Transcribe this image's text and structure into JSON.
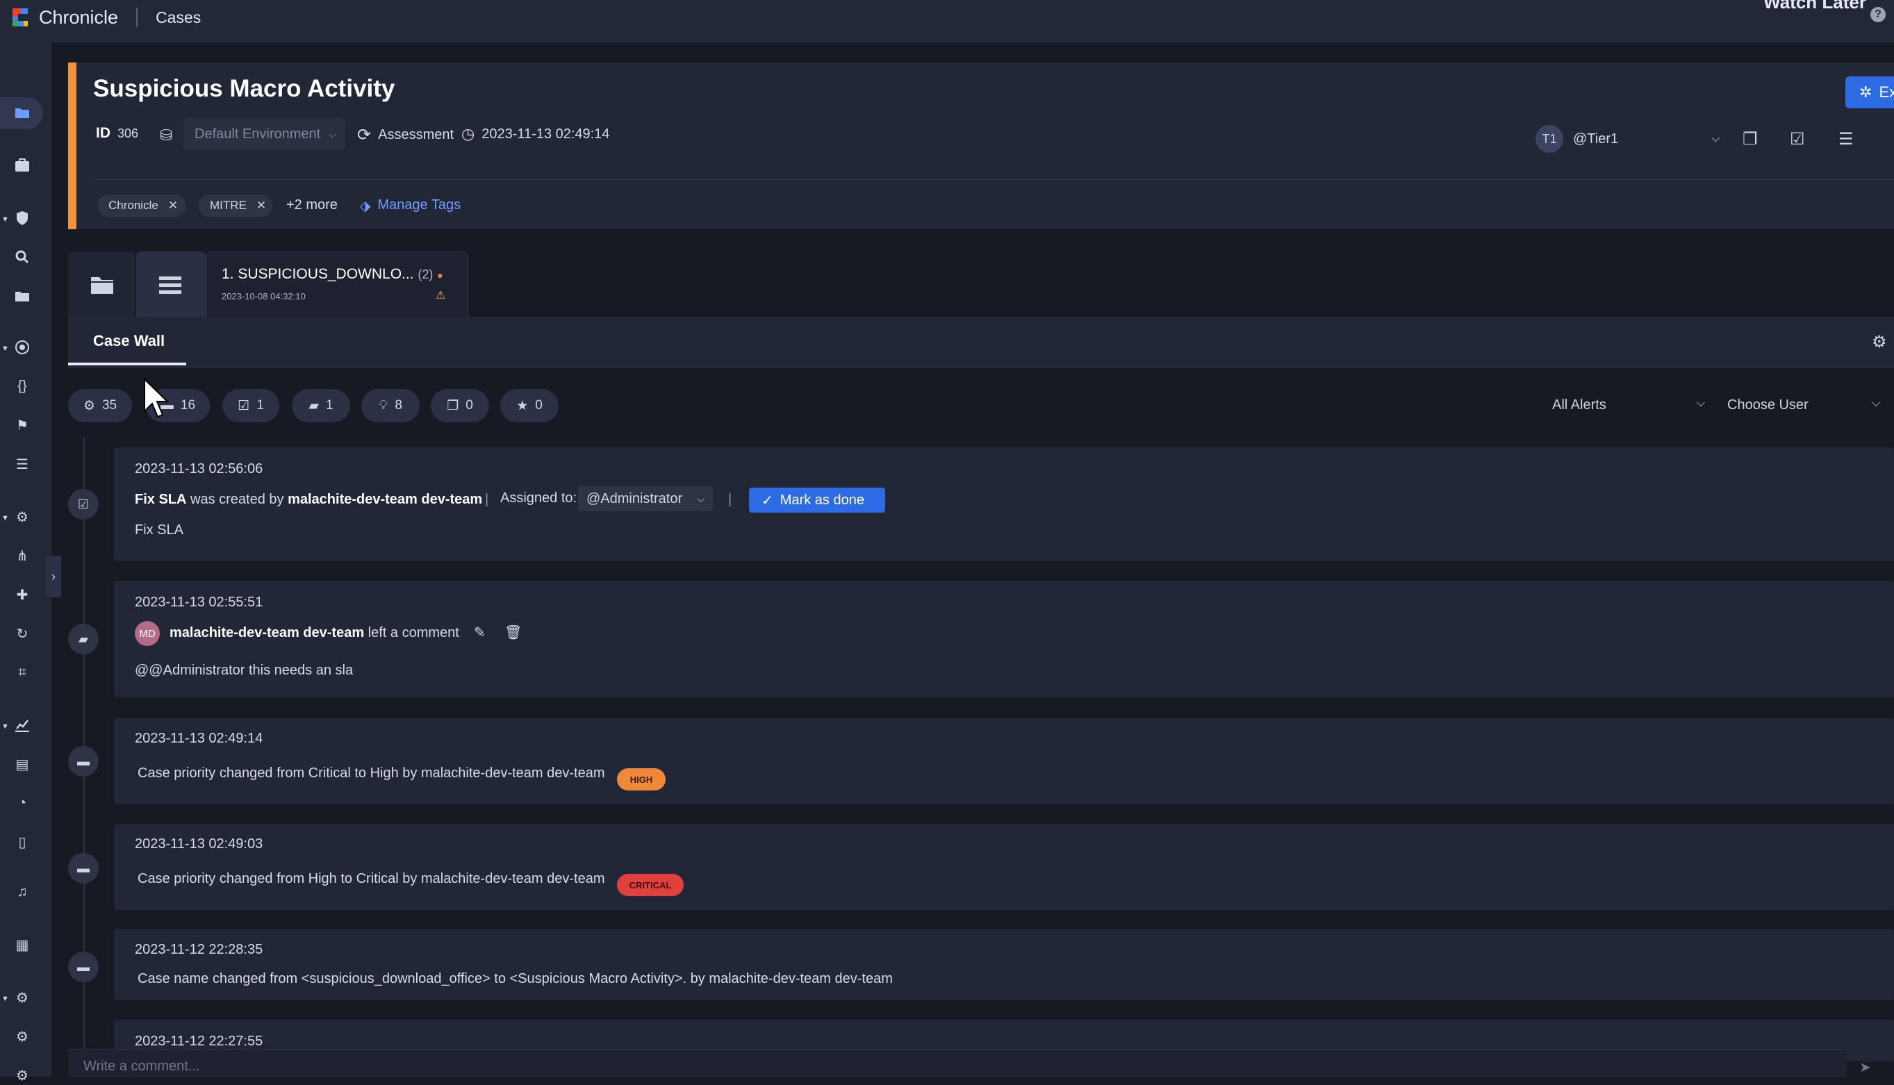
{
  "app": {
    "name": "Chronicle",
    "section": "Cases",
    "watch_later": "Watch Later",
    "help_icon": "help-icon"
  },
  "case": {
    "title": "Suspicious Macro Activity",
    "id_label": "ID",
    "id_value": "306",
    "environment": "Default Environment",
    "stage": "Assessment",
    "timestamp": "2023-11-13 02:49:14",
    "tags": [
      "Chronicle",
      "MITRE"
    ],
    "more_tags": "+2 more",
    "manage_tags": "Manage Tags",
    "assignee_initials": "T1",
    "assignee": "@Tier1",
    "execute_label": "Ex",
    "accent_color": "#f5923e"
  },
  "alert_tab": {
    "title": "1. SUSPICIOUS_DOWNLO...",
    "count": "(2)",
    "date": "2023-10-08 04:32:10"
  },
  "wall": {
    "tab_label": "Case Wall"
  },
  "filters": {
    "chips": [
      {
        "icon": "gear-icon",
        "count": "35"
      },
      {
        "icon": "folder-icon",
        "count": "16"
      },
      {
        "icon": "task-icon",
        "count": "1"
      },
      {
        "icon": "comment-icon",
        "count": "1"
      },
      {
        "icon": "insight-icon",
        "count": "8"
      },
      {
        "icon": "chat-icon",
        "count": "0"
      },
      {
        "icon": "star-icon",
        "count": "0"
      }
    ],
    "alerts_dropdown": "All Alerts",
    "user_dropdown": "Choose User"
  },
  "events": [
    {
      "date": "2023-11-13 02:56:06",
      "task_name": "Fix SLA",
      "created_by_text": "was created by",
      "creator": "malachite-dev-team dev-team",
      "assigned_label": "Assigned to:",
      "assigned_value": "@Administrator",
      "mark_done": "Mark as done",
      "body": "Fix SLA"
    },
    {
      "date": "2023-11-13 02:55:51",
      "initials": "MD",
      "author": "malachite-dev-team dev-team",
      "action": "left a comment",
      "body": "@@Administrator this needs an sla"
    },
    {
      "date": "2023-11-13 02:49:14",
      "body": "Case priority changed from Critical to High by malachite-dev-team dev-team",
      "badge": "HIGH",
      "badge_color": "#f0883a"
    },
    {
      "date": "2023-11-13 02:49:03",
      "body": "Case priority changed from High to Critical by malachite-dev-team dev-team",
      "badge": "CRITICAL",
      "badge_color": "#e0413d"
    },
    {
      "date": "2023-11-12 22:28:35",
      "body": "Case name changed from <suspicious_download_office> to <Suspicious Macro Activity>. by malachite-dev-team dev-team"
    },
    {
      "date": "2023-11-12 22:27:55"
    }
  ],
  "comment": {
    "placeholder": "Write a comment..."
  }
}
